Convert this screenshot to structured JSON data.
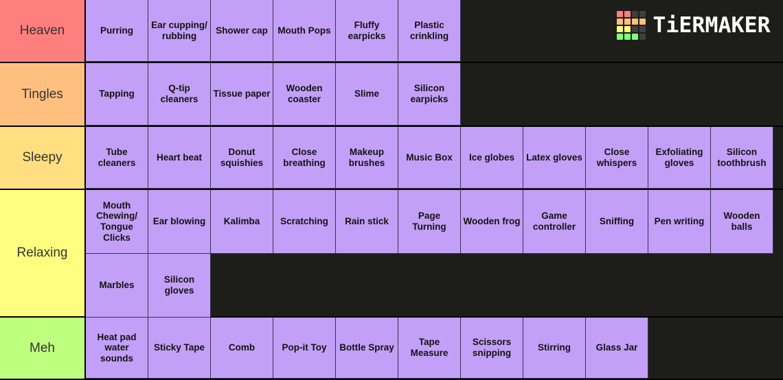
{
  "app": {
    "brand_name": "TiERMAKER",
    "background_color": "#1d1e19",
    "item_color": "#c3a0f7",
    "item_text_color": "#121212",
    "logo_palette": {
      "red": "#ff7f7f",
      "orange": "#ffbf7f",
      "yellow": "#ffff7f",
      "green": "#7fff7f",
      "empty": "#3f3f3f"
    },
    "logo_cells": [
      "red",
      "red",
      "empty",
      "empty",
      "orange",
      "orange",
      "orange",
      "orange",
      "yellow",
      "yellow",
      "empty",
      "empty",
      "green",
      "green",
      "green",
      "empty"
    ]
  },
  "tiers": [
    {
      "label": "Heaven",
      "color": "#ff7f7f",
      "items": [
        "Purring",
        "Ear cupping/ rubbing",
        "Shower cap",
        "Mouth Pops",
        "Fluffy earpicks",
        "Plastic crinkling"
      ]
    },
    {
      "label": "Tingles",
      "color": "#ffbf7f",
      "items": [
        "Tapping",
        "Q-tip cleaners",
        "Tissue paper",
        "Wooden coaster",
        "Slime",
        "Silicon earpicks"
      ]
    },
    {
      "label": "Sleepy",
      "color": "#ffdf7f",
      "items": [
        "Tube cleaners",
        "Heart beat",
        "Donut squishies",
        "Close breathing",
        "Makeup brushes",
        "Music Box",
        "Ice globes",
        "Latex gloves",
        "Close whispers",
        "Exfoliating gloves",
        "Silicon toothbrush"
      ]
    },
    {
      "label": "Relaxing",
      "color": "#ffff7f",
      "items": [
        "Mouth Chewing/ Tongue Clicks",
        "Ear blowing",
        "Kalimba",
        "Scratching",
        "Rain stick",
        "Page Turning",
        "Wooden frog",
        "Game controller",
        "Sniffing",
        "Pen writing",
        "Wooden balls",
        "Marbles",
        "Silicon gloves"
      ]
    },
    {
      "label": "Meh",
      "color": "#bfff7f",
      "items": [
        "Heat pad water sounds",
        "Sticky Tape",
        "Comb",
        "Pop-it Toy",
        "Bottle Spray",
        "Tape Measure",
        "Scissors snipping",
        "Stirring",
        "Glass Jar"
      ]
    }
  ]
}
